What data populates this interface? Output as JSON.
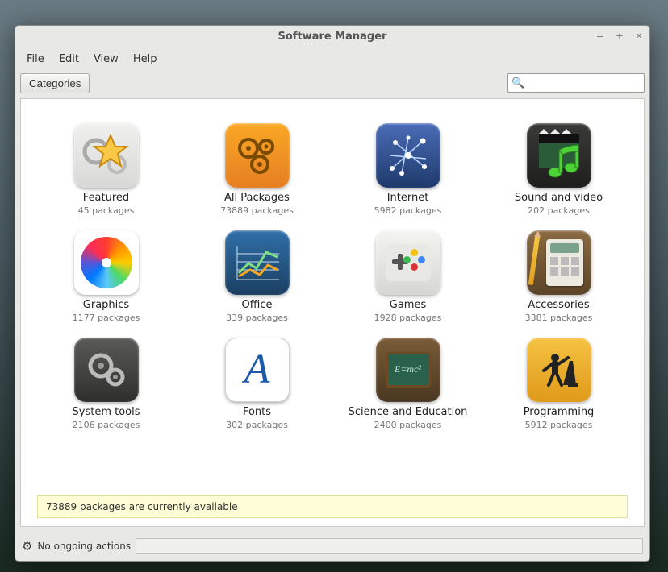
{
  "window": {
    "title": "Software Manager"
  },
  "menu": {
    "file": "File",
    "edit": "Edit",
    "view": "View",
    "help": "Help"
  },
  "toolbar": {
    "categories_label": "Categories",
    "search_placeholder": ""
  },
  "categories": [
    {
      "icon": "featured",
      "label": "Featured",
      "count": "45 packages"
    },
    {
      "icon": "all",
      "label": "All Packages",
      "count": "73889 packages"
    },
    {
      "icon": "internet",
      "label": "Internet",
      "count": "5982 packages"
    },
    {
      "icon": "sound",
      "label": "Sound and video",
      "count": "202 packages"
    },
    {
      "icon": "graphics",
      "label": "Graphics",
      "count": "1177 packages"
    },
    {
      "icon": "office",
      "label": "Office",
      "count": "339 packages"
    },
    {
      "icon": "games",
      "label": "Games",
      "count": "1928 packages"
    },
    {
      "icon": "accessories",
      "label": "Accessories",
      "count": "3381 packages"
    },
    {
      "icon": "system",
      "label": "System tools",
      "count": "2106 packages"
    },
    {
      "icon": "fonts",
      "label": "Fonts",
      "count": "302 packages"
    },
    {
      "icon": "science",
      "label": "Science and Education",
      "count": "2400 packages"
    },
    {
      "icon": "programming",
      "label": "Programming",
      "count": "5912 packages"
    }
  ],
  "status": {
    "message": "73889 packages are currently available"
  },
  "footer": {
    "actions_label": "No ongoing actions"
  }
}
